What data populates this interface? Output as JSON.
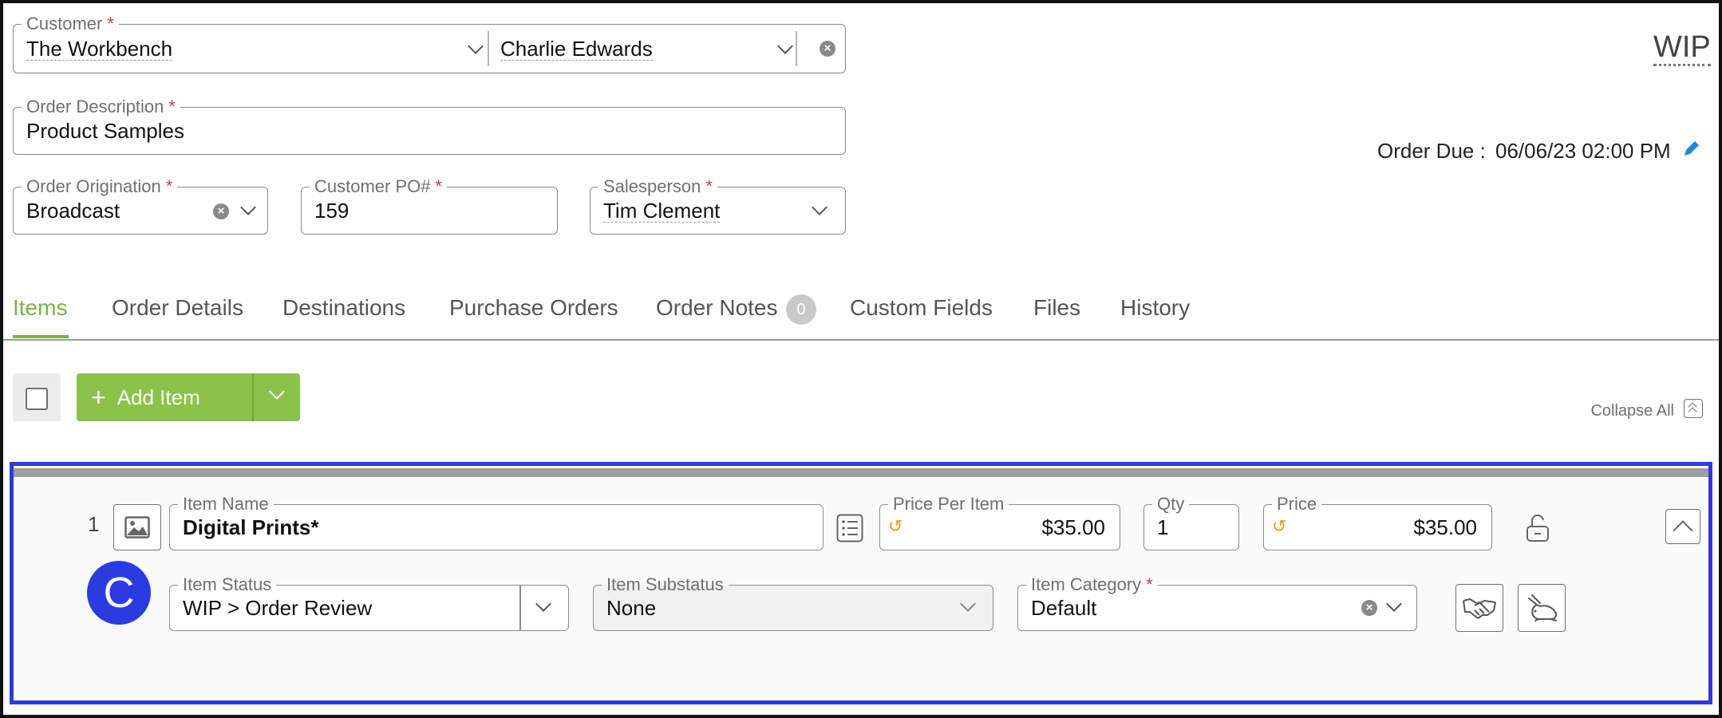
{
  "header": {
    "customer": {
      "label": "Customer",
      "required": "*",
      "company": "The Workbench",
      "contact": "Charlie Edwards"
    },
    "order_description": {
      "label": "Order Description",
      "required": "*",
      "value": "Product Samples"
    },
    "order_origination": {
      "label": "Order Origination",
      "required": "*",
      "value": "Broadcast"
    },
    "customer_po": {
      "label": "Customer PO#",
      "required": "*",
      "value": "159"
    },
    "salesperson": {
      "label": "Salesperson",
      "required": "*",
      "value": "Tim Clement"
    },
    "status": "WIP",
    "order_due": {
      "label": "Order Due :",
      "value": "06/06/23 02:00 PM"
    }
  },
  "tabs": [
    {
      "label": "Items"
    },
    {
      "label": "Order Details"
    },
    {
      "label": "Destinations"
    },
    {
      "label": "Purchase Orders"
    },
    {
      "label": "Order Notes",
      "badge": "0"
    },
    {
      "label": "Custom Fields"
    },
    {
      "label": "Files"
    },
    {
      "label": "History"
    }
  ],
  "toolbar": {
    "add_item_label": "Add Item",
    "add_item_icon": "+",
    "collapse_all_label": "Collapse All"
  },
  "item": {
    "index": "1",
    "name": {
      "label": "Item Name",
      "value": "Digital Prints*"
    },
    "price_per_item": {
      "label": "Price Per Item",
      "value": "$35.00"
    },
    "qty": {
      "label": "Qty",
      "value": "1"
    },
    "price": {
      "label": "Price",
      "value": "$35.00"
    },
    "status": {
      "label": "Item Status",
      "value": "WIP > Order Review"
    },
    "substatus": {
      "label": "Item Substatus",
      "value": "None"
    },
    "category": {
      "label": "Item Category",
      "required": "*",
      "value": "Default"
    },
    "avatar_letter": "C"
  },
  "colors": {
    "accent_green": "#8bc34a",
    "active_tab": "#7cb342",
    "highlight_blue": "#2e3ae0",
    "required_red": "#d93a3a",
    "edit_blue": "#1e88e5"
  }
}
